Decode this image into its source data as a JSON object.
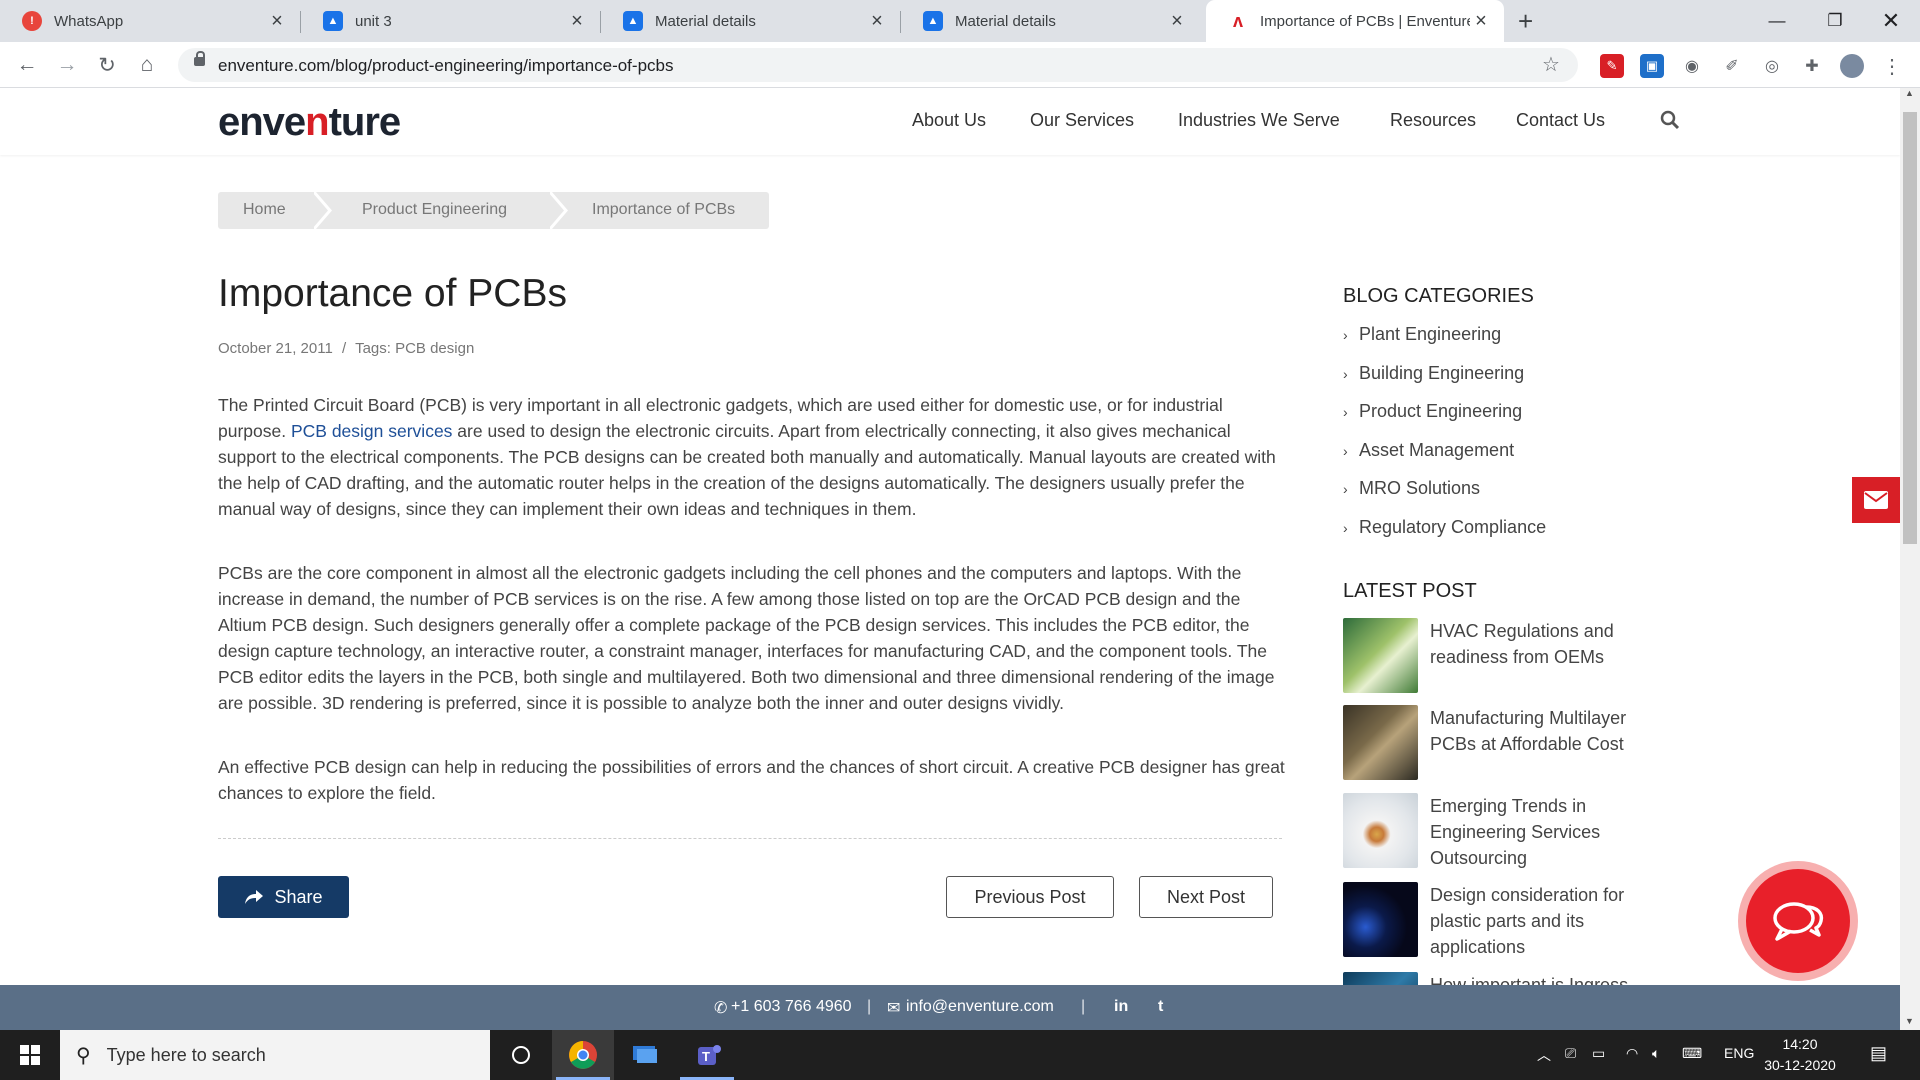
{
  "browser": {
    "tabs": [
      {
        "label": "WhatsApp",
        "icon": "whatsapp-alert-icon",
        "color": "#e8453c"
      },
      {
        "label": "unit 3",
        "icon": "classroom-icon",
        "color": "#1a73e8"
      },
      {
        "label": "Material details",
        "icon": "classroom-icon",
        "color": "#1a73e8"
      },
      {
        "label": "Material details",
        "icon": "classroom-icon",
        "color": "#1a73e8"
      },
      {
        "label": "Importance of PCBs | Enventure",
        "icon": "enventure-icon",
        "color": "#d81f26",
        "active": true
      }
    ],
    "new_tab": "+",
    "url": "enventure.com/blog/product-engineering/importance-of-pcbs"
  },
  "site": {
    "logo": {
      "before": "enve",
      "mark": "n",
      "after": "ture"
    },
    "nav": [
      "About Us",
      "Our Services",
      "Industries We Serve",
      "Resources",
      "Contact Us"
    ],
    "breadcrumb": [
      "Home",
      "Product Engineering",
      "Importance of PCBs"
    ]
  },
  "article": {
    "title": "Importance of PCBs",
    "date": "October 21, 2011",
    "meta_sep": "/",
    "tags": "Tags: PCB design",
    "p1_a": "The Printed Circuit Board (PCB) is very important in all electronic gadgets, which are used either for domestic use, or for industrial purpose. ",
    "p1_link": "PCB design services",
    "p1_b": " are used to design the electronic circuits. Apart from electrically connecting, it also gives mechanical support to the electrical components. The PCB designs can be created both manually and automatically. Manual layouts are created with the help of CAD drafting, and the automatic router helps in the creation of the designs automatically. The designers usually prefer the manual way of designs, since they can implement their own ideas and techniques in them.",
    "p2": "PCBs are the core component in almost all the electronic gadgets including the cell phones and the computers and laptops. With the increase in demand, the number of PCB services is on the rise. A few among those listed on top are the OrCAD PCB design and the Altium PCB design. Such designers generally offer a complete package of the PCB design services. This includes the PCB editor, the design capture technology, an interactive router, a constraint manager, interfaces for manufacturing CAD, and the component tools. The PCB editor edits the layers in the PCB, both single and multilayered. Both two dimensional and three dimensional rendering of the image are possible. 3D rendering is preferred, since it is possible to analyze both the inner and outer designs vividly.",
    "p3": "An effective PCB design can help in reducing the possibilities of errors and the chances of short circuit. A creative PCB designer has great chances to explore the field.",
    "share": "Share",
    "prev": "Previous Post",
    "next": "Next Post"
  },
  "sidebar": {
    "categories_heading": "BLOG CATEGORIES",
    "categories": [
      "Plant Engineering",
      "Building Engineering",
      "Product Engineering",
      "Asset Management",
      "MRO Solutions",
      "Regulatory Compliance"
    ],
    "latest_heading": "LATEST POST",
    "posts": [
      "HVAC Regulations and readiness from OEMs",
      "Manufacturing Multilayer PCBs at Affordable Cost",
      "Emerging Trends in Engineering Services Outsourcing",
      "Design consideration for plastic parts and its applications",
      "How important is Ingress Protection (IP) Rating for"
    ]
  },
  "footer": {
    "phone": "+1 603 766 4960",
    "email": "info@enventure.com",
    "sep": "|",
    "social": [
      "in",
      "t"
    ]
  },
  "taskbar": {
    "search_placeholder": "Type here to search",
    "lang": "ENG",
    "time": "14:20",
    "date": "30-12-2020"
  },
  "colors": {
    "brand_red": "#d81f26",
    "brand_navy": "#153a66",
    "footer_bg": "#5a6f87",
    "link": "#1e4f97"
  }
}
